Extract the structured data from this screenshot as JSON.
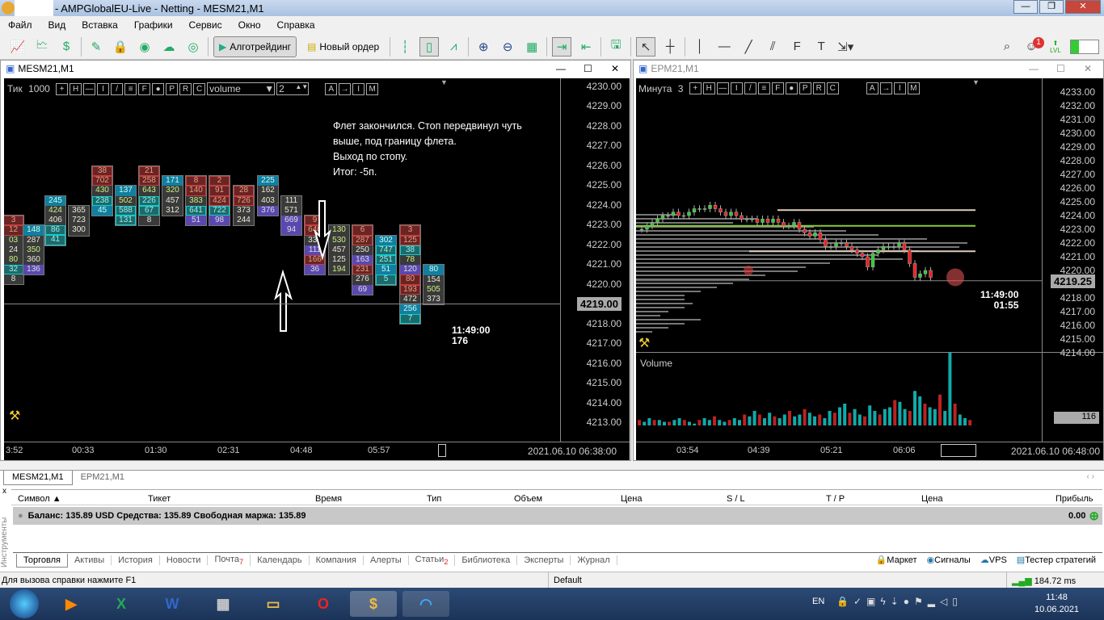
{
  "window": {
    "title": "- AMPGlobalEU-Live - Netting - MESM21,M1"
  },
  "menu": [
    "Файл",
    "Вид",
    "Вставка",
    "Графики",
    "Сервис",
    "Окно",
    "Справка"
  ],
  "toolbar": {
    "algo": "Алготрейдинг",
    "new_order": "Новый ордер",
    "notif_count": "1",
    "lvl": "LVL"
  },
  "left": {
    "title": "MESM21,M1",
    "mode": "Тик",
    "mode_val": "1000",
    "btns": [
      "+",
      "H",
      "—",
      "I",
      "/",
      "≡",
      "F",
      "●",
      "P",
      "R",
      "C"
    ],
    "right_btns": [
      "A",
      "→",
      "I",
      "M"
    ],
    "select": "volume",
    "spin": "2",
    "prices": [
      "4230.00",
      "4229.00",
      "4228.00",
      "4227.00",
      "4226.00",
      "4225.00",
      "4224.00",
      "4223.00",
      "4222.00",
      "4221.00",
      "4220.00",
      "4219.00",
      "4218.00",
      "4217.00",
      "4216.00",
      "4215.00",
      "4214.00",
      "4213.00"
    ],
    "current": "4219.00",
    "current_val": 4219.0,
    "timer": "11:49:00",
    "ticks": "176",
    "times": [
      "3:52",
      "00:33",
      "01:30",
      "02:31",
      "04:48",
      "05:57"
    ],
    "date": "2021.06.10 06:38:00",
    "note": [
      "Флет закончился. Стоп передвинул чуть",
      "выше, под границу флета.",
      "Выход по стопу.",
      "Итог: -5п."
    ],
    "columns": [
      {
        "top": 4223.25,
        "v": [
          "3",
          "12",
          "03",
          "24",
          "80",
          "32",
          "8"
        ],
        "s": [
          "r",
          "r",
          "g",
          "",
          "g",
          "c",
          ""
        ]
      },
      {
        "top": 4222.75,
        "v": [
          "148",
          "287",
          "350",
          "360",
          "136"
        ],
        "s": [
          "b",
          "",
          "g",
          "",
          "p"
        ]
      },
      {
        "top": 4224.25,
        "v": [
          "245",
          "424",
          "406",
          "86",
          "41"
        ],
        "s": [
          "b",
          "g",
          "",
          "c",
          "c"
        ]
      },
      {
        "top": 4223.75,
        "v": [
          "365",
          "723",
          "300"
        ],
        "s": [
          "",
          "",
          ""
        ]
      },
      {
        "top": 4225.75,
        "v": [
          "38",
          "702",
          "430",
          "238",
          "45"
        ],
        "s": [
          "r",
          "r",
          "g",
          "c",
          "b"
        ]
      },
      {
        "top": 4224.75,
        "v": [
          "137",
          "502",
          "588",
          "131"
        ],
        "s": [
          "b",
          "g",
          "c",
          "c"
        ]
      },
      {
        "top": 4225.75,
        "v": [
          "21",
          "258",
          "643",
          "226",
          "67",
          "8"
        ],
        "s": [
          "r",
          "r",
          "g",
          "c",
          "c",
          ""
        ]
      },
      {
        "top": 4225.25,
        "v": [
          "171",
          "320",
          "457",
          "312"
        ],
        "s": [
          "b",
          "g",
          "",
          ""
        ]
      },
      {
        "top": 4225.25,
        "v": [
          "8",
          "140",
          "383",
          "641",
          "51"
        ],
        "s": [
          "r",
          "r",
          "g",
          "c",
          "p"
        ]
      },
      {
        "top": 4225.25,
        "v": [
          "2",
          "91",
          "424",
          "722",
          "98"
        ],
        "s": [
          "r",
          "r",
          "r",
          "c",
          "p"
        ]
      },
      {
        "top": 4224.75,
        "v": [
          "28",
          "726",
          "373",
          "244"
        ],
        "s": [
          "r",
          "r",
          "",
          ""
        ]
      },
      {
        "top": 4225.25,
        "v": [
          "225",
          "162",
          "403",
          "376"
        ],
        "s": [
          "b",
          "",
          "",
          "p"
        ]
      },
      {
        "top": 4224.25,
        "v": [
          "111",
          "571",
          "669",
          "94"
        ],
        "s": [
          "",
          "",
          "p",
          "p"
        ]
      },
      {
        "top": 4223.25,
        "v": [
          "9",
          "640",
          "334",
          "111",
          "166",
          "36"
        ],
        "s": [
          "r",
          "r",
          "",
          "p",
          "r",
          "p"
        ]
      },
      {
        "top": 4222.75,
        "v": [
          "130",
          "530",
          "457",
          "125",
          "194"
        ],
        "s": [
          "g",
          "g",
          "",
          "",
          "g"
        ]
      },
      {
        "top": 4222.75,
        "v": [
          "6",
          "287",
          "250",
          "163",
          "231",
          "276",
          "69"
        ],
        "s": [
          "r",
          "r",
          "",
          "p",
          "r",
          "",
          "p"
        ]
      },
      {
        "top": 4222.25,
        "v": [
          "302",
          "747",
          "251",
          "51",
          "5"
        ],
        "s": [
          "b",
          "c",
          "c",
          "b",
          "c"
        ]
      },
      {
        "top": 4222.75,
        "v": [
          "3",
          "125",
          "38",
          "78",
          "120",
          "80",
          "193",
          "472",
          "256",
          "7"
        ],
        "s": [
          "r",
          "r",
          "c",
          "g",
          "p",
          "r",
          "r",
          "",
          "b",
          "c"
        ]
      },
      {
        "top": 4220.75,
        "v": [
          "80",
          "154",
          "505",
          "373"
        ],
        "s": [
          "b",
          "",
          "g",
          ""
        ]
      }
    ]
  },
  "right": {
    "title": "EPM21,M1",
    "mode": "Минута",
    "mode_val": "3",
    "btns": [
      "+",
      "H",
      "—",
      "I",
      "/",
      "≡",
      "F",
      "●",
      "P",
      "R",
      "C"
    ],
    "right_btns": [
      "A",
      "→",
      "I",
      "M"
    ],
    "prices": [
      "4233.00",
      "4232.00",
      "4231.00",
      "4230.00",
      "4229.00",
      "4228.00",
      "4227.00",
      "4226.00",
      "4225.00",
      "4224.00",
      "4223.00",
      "4222.00",
      "4221.00",
      "4220.00",
      "4219.00",
      "4218.00",
      "4217.00",
      "4216.00",
      "4215.00",
      "4214.00"
    ],
    "current": "4219.25",
    "current_val": 4219.25,
    "timer": "11:49:00",
    "remaining": "01:55",
    "volume_label": "Volume",
    "volume_value": "116",
    "times": [
      "03:54",
      "04:39",
      "05:21",
      "06:06"
    ],
    "date": "2021.06.10 06:48:00",
    "closes": [
      4223.0,
      4223.25,
      4223.5,
      4223.75,
      4224.0,
      4224.0,
      4224.25,
      4224.0,
      4224.0,
      4224.25,
      4224.5,
      4224.5,
      4224.5,
      4224.75,
      4224.5,
      4224.25,
      4224.0,
      4224.25,
      4224.0,
      4223.75,
      4223.75,
      4223.75,
      4223.5,
      4223.75,
      4223.5,
      4223.75,
      4223.5,
      4223.25,
      4223.25,
      4223.5,
      4223.0,
      4222.75,
      4222.5,
      4222.75,
      4222.25,
      4221.75,
      4221.75,
      4222.0,
      4222.0,
      4221.75,
      4221.5,
      4221.25,
      4221.0,
      4220.25,
      4221.25,
      4221.5,
      4221.75,
      4221.75,
      4221.75,
      4222.0,
      4221.5,
      4220.5,
      4219.5,
      4219.75,
      4220.0,
      4219.5
    ],
    "volume": [
      3,
      2,
      4,
      3,
      3,
      2,
      2,
      3,
      4,
      3,
      2,
      1,
      3,
      4,
      3,
      5,
      3,
      2,
      3,
      4,
      3,
      6,
      5,
      8,
      6,
      4,
      7,
      5,
      4,
      6,
      8,
      5,
      6,
      9,
      7,
      5,
      6,
      4,
      8,
      7,
      10,
      12,
      7,
      9,
      6,
      5,
      11,
      8,
      6,
      9,
      10,
      14,
      13,
      9,
      8,
      19,
      16,
      12,
      10,
      9,
      17,
      8,
      40,
      12,
      6,
      4,
      3
    ],
    "profile": [
      50,
      150,
      120,
      220,
      260,
      300,
      360,
      410,
      400,
      350,
      300,
      330,
      240,
      210,
      200,
      160,
      140,
      120,
      100,
      80,
      60,
      60,
      70,
      60,
      40,
      30,
      80,
      60,
      40,
      20
    ]
  },
  "terminal": {
    "tabs": [
      "MESM21,M1",
      "EPM21,M1"
    ],
    "headers": [
      "Символ",
      "Тикет",
      "Время",
      "Тип",
      "Объем",
      "Цена",
      "S / L",
      "T / P",
      "Цена",
      "Прибыль"
    ],
    "balance": "Баланс: 135.89 USD  Средства: 135.89  Свободная маржа: 135.89",
    "profit": "0.00",
    "side": "Инструменты",
    "bottom_tabs": [
      "Торговля",
      "Активы",
      "История",
      "Новости",
      "Почта",
      "Календарь",
      "Компания",
      "Алерты",
      "Статьи",
      "Библиотека",
      "Эксперты",
      "Журнал"
    ],
    "mail_badge": "7",
    "articles_badge": "2",
    "right_links": [
      "Маркет",
      "Сигналы",
      "VPS",
      "Тестер стратегий"
    ]
  },
  "status": {
    "help": "Для вызова справки нажмите F1",
    "profile": "Default",
    "ping": "184.72 ms"
  },
  "taskbar": {
    "lang": "EN",
    "time": "11:48",
    "date": "10.06.2021"
  }
}
